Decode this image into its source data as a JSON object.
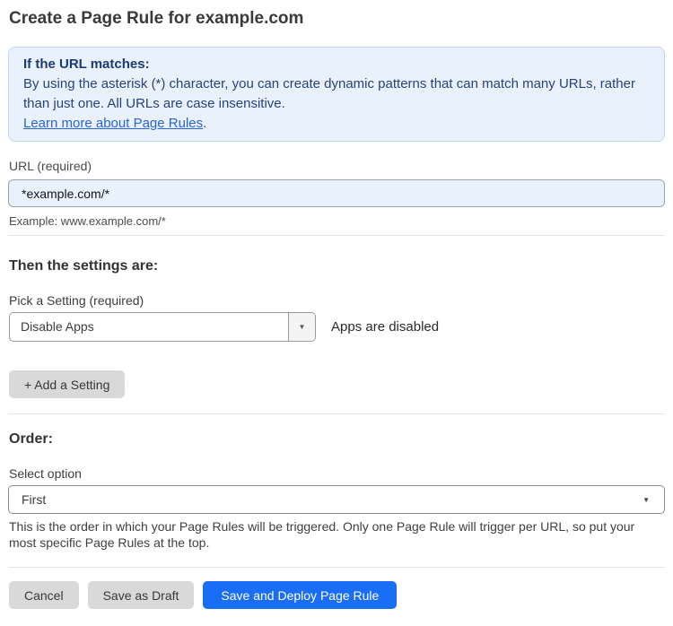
{
  "page": {
    "title": "Create a Page Rule for example.com"
  },
  "info_box": {
    "heading": "If the URL matches:",
    "body": "By using the asterisk (*) character, you can create dynamic patterns that can match many URLs, rather than just one. All URLs are case insensitive.",
    "link_label": "Learn more about Page Rules",
    "link_suffix": "."
  },
  "url_field": {
    "label": "URL (required)",
    "value": "*example.com/*",
    "example": "Example: www.example.com/*"
  },
  "settings_section": {
    "heading": "Then the settings are:",
    "picker_label": "Pick a Setting (required)",
    "selected_setting": "Disable Apps",
    "status_text": "Apps are disabled",
    "add_button_label": "+ Add a Setting",
    "caret_glyph": "▼"
  },
  "order_section": {
    "heading": "Order:",
    "select_label": "Select option",
    "selected_option": "First",
    "caret_glyph": "▼",
    "help_text": "This is the order in which your Page Rules will be triggered. Only one Page Rule will trigger per URL, so put your most specific Page Rules at the top."
  },
  "actions": {
    "cancel_label": "Cancel",
    "save_draft_label": "Save as Draft",
    "save_deploy_label": "Save and Deploy Page Rule"
  },
  "colors": {
    "info_box_bg": "#e9f2fc",
    "info_box_border": "#bcd8f2",
    "info_text": "#29417c",
    "link_blue": "#2b63d9",
    "input_bg": "#e8f1fc",
    "primary_button_blue": "#1a6ef5",
    "gray_button": "#d9d9d9"
  }
}
